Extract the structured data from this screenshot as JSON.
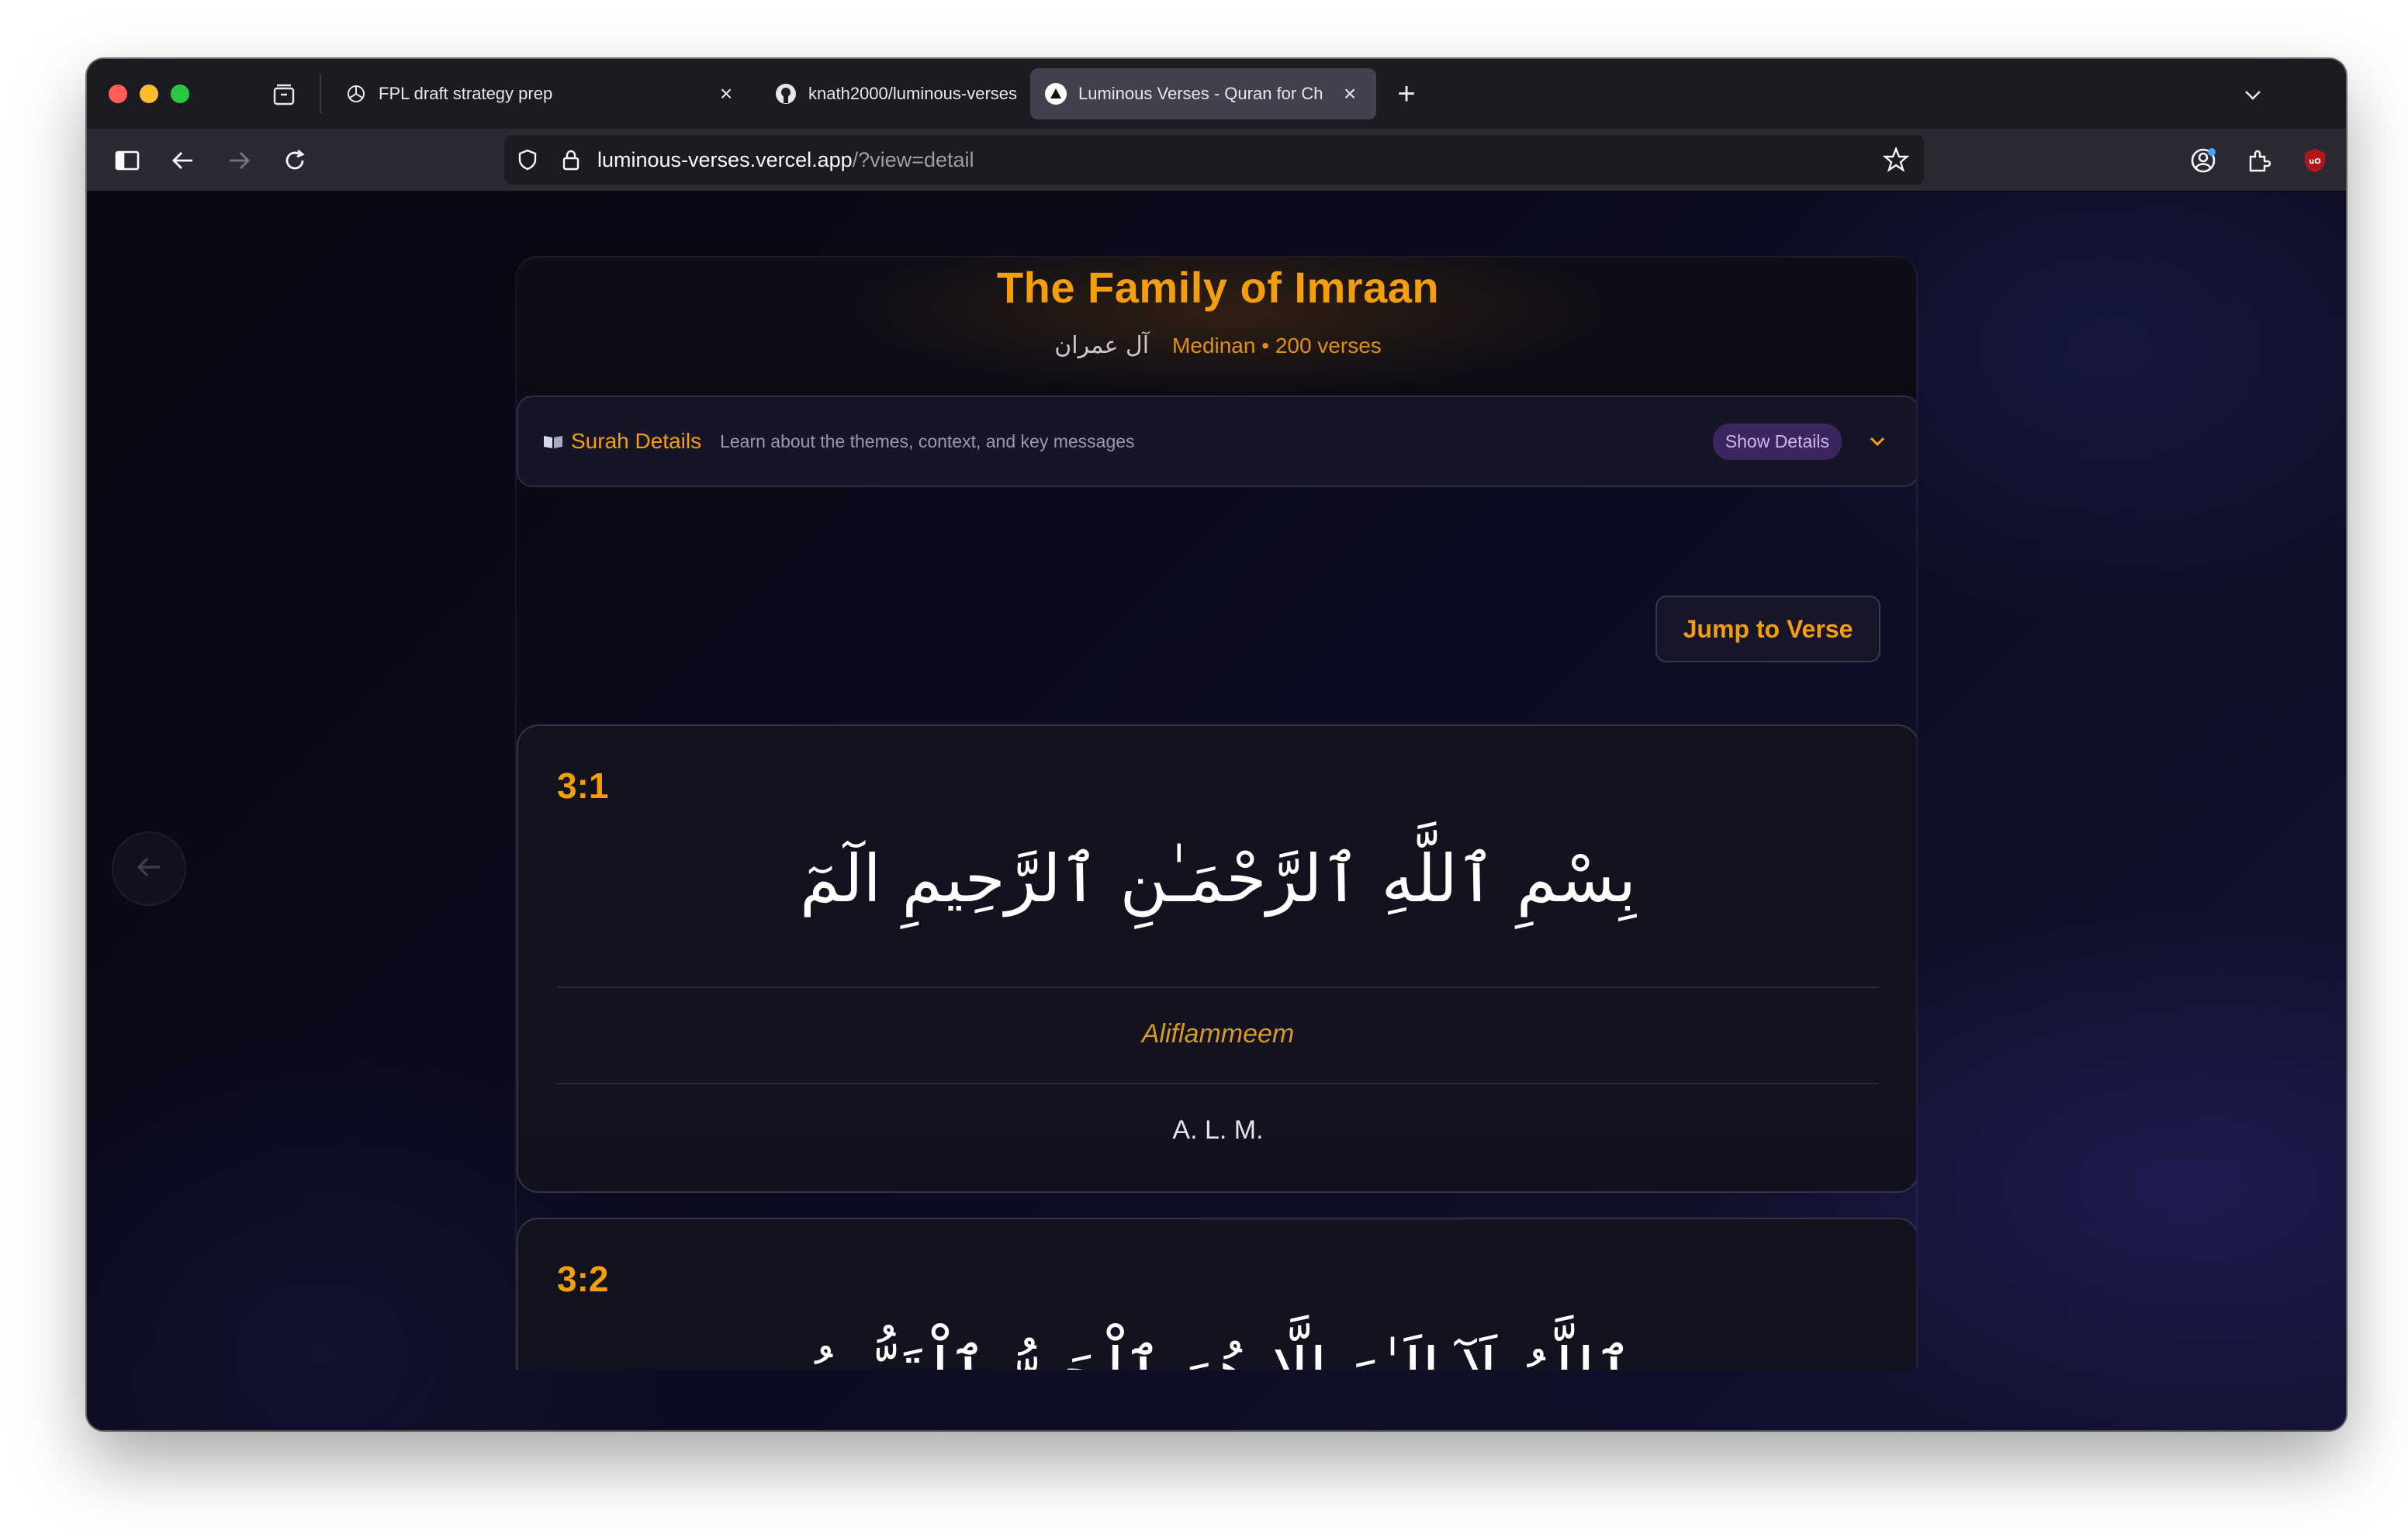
{
  "browser": {
    "tabs": [
      {
        "title": "FPL draft strategy prep",
        "favicon": "openai-icon",
        "active": false
      },
      {
        "title": "knath2000/luminous-verses",
        "favicon": "github-icon",
        "active": false
      },
      {
        "title": "Luminous Verses - Quran for Ch",
        "favicon": "vercel-icon",
        "active": true
      }
    ],
    "url": {
      "host": "luminous-verses.vercel.app",
      "path": "/?view=detail"
    }
  },
  "surah": {
    "title": "The Family of Imraan",
    "arabic_name": "آل عمران",
    "meta": "Medinan • 200 verses"
  },
  "details": {
    "title": "Surah Details",
    "description": "Learn about the themes, context, and key messages",
    "show_label": "Show Details"
  },
  "jump": {
    "label": "Jump to Verse"
  },
  "verses": [
    {
      "number": "3:1",
      "arabic": "بِسْمِ ٱللَّهِ ٱلرَّحْمَـٰنِ ٱلرَّحِيمِ الٓمٓ",
      "transliteration": "Aliflammeem",
      "translation": "A. L. M."
    },
    {
      "number": "3:2",
      "arabic": "ٱللَّهُ لَآ إِلَـٰهَ إِلَّا هُوَ ٱلْحَىُّ ٱلْقَيُّومُ"
    }
  ],
  "colors": {
    "accent": "#f59e0b",
    "background": "#0b0b1c",
    "card_border": "#353446",
    "badge_bg": "#3b2660"
  }
}
